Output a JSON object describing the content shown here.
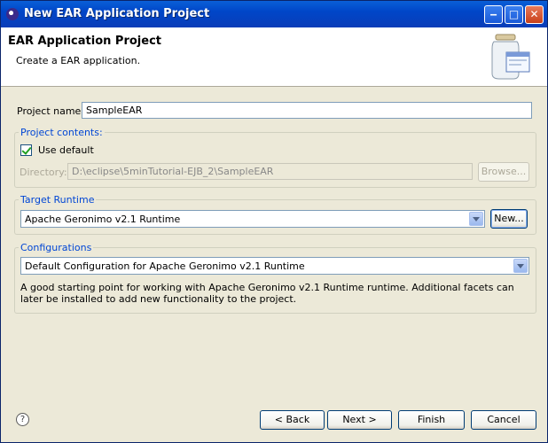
{
  "window": {
    "title": "New EAR Application Project",
    "controls": [
      "minimize",
      "maximize",
      "close"
    ]
  },
  "banner": {
    "title": "EAR Application Project",
    "description": "Create a EAR application."
  },
  "project_name": {
    "label": "Project name:",
    "value": "SampleEAR"
  },
  "project_contents": {
    "group_label": "Project contents:",
    "use_default_label": "Use default",
    "use_default_checked": true,
    "directory_label": "Directory:",
    "directory_value": "D:\\eclipse\\5minTutorial-EJB_2\\SampleEAR",
    "browse_label": "Browse..."
  },
  "target_runtime": {
    "group_label": "Target Runtime",
    "selected": "Apache Geronimo v2.1 Runtime",
    "new_label": "New..."
  },
  "configurations": {
    "group_label": "Configurations",
    "selected": "Default Configuration for Apache Geronimo v2.1 Runtime",
    "description": "A good starting point for working with Apache Geronimo v2.1 Runtime runtime. Additional facets can later be installed to add new functionality to the project."
  },
  "footer": {
    "help_symbol": "?",
    "back_label": "< Back",
    "next_label": "Next >",
    "finish_label": "Finish",
    "cancel_label": "Cancel"
  },
  "icons": {
    "title": "eclipse-icon",
    "banner": "jar-wizard-icon",
    "help": "help-icon"
  }
}
